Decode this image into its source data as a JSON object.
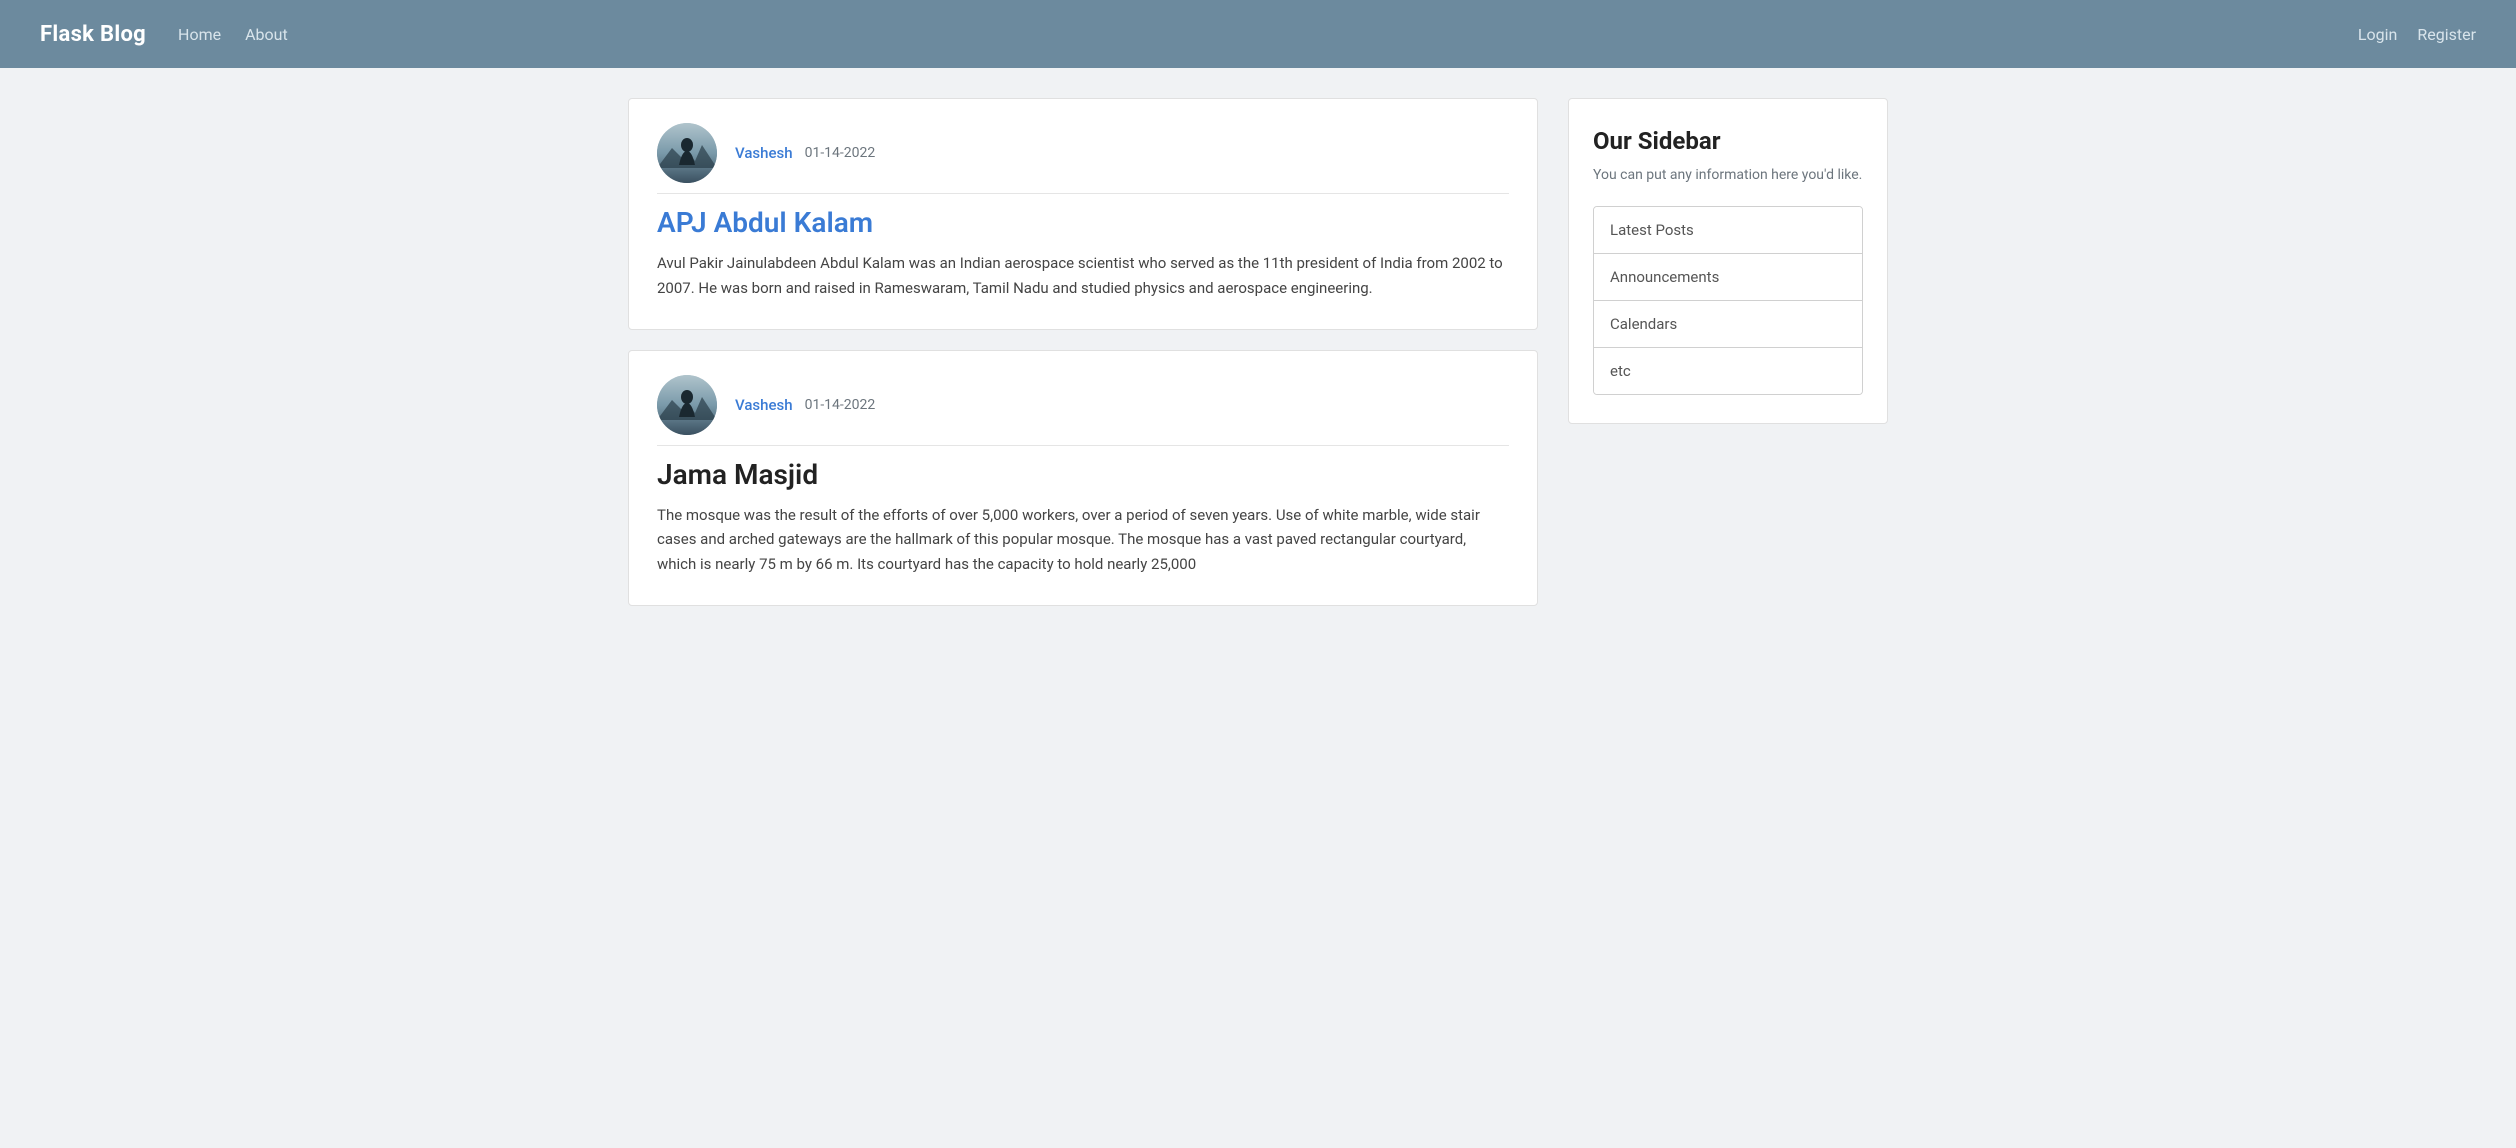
{
  "navbar": {
    "brand": "Flask Blog",
    "links": [
      {
        "label": "Home",
        "href": "#"
      },
      {
        "label": "About",
        "href": "#"
      }
    ],
    "right_links": [
      {
        "label": "Login",
        "href": "#"
      },
      {
        "label": "Register",
        "href": "#"
      }
    ]
  },
  "posts": [
    {
      "author": "Vashesh",
      "date": "01-14-2022",
      "title": "APJ Abdul Kalam",
      "title_style": "blue",
      "body": "Avul Pakir Jainulabdeen Abdul Kalam was an Indian aerospace scientist who served as the 11th president of India from 2002 to 2007. He was born and raised in Rameswaram, Tamil Nadu and studied physics and aerospace engineering."
    },
    {
      "author": "Vashesh",
      "date": "01-14-2022",
      "title": "Jama Masjid",
      "title_style": "dark",
      "body": "The mosque was the result of the efforts of over 5,000 workers, over a period of seven years. Use of white marble, wide stair cases and arched gateways are the hallmark of this popular mosque. The mosque has a vast paved rectangular courtyard, which is nearly 75 m by 66 m. Its courtyard has the capacity to hold nearly 25,000"
    }
  ],
  "sidebar": {
    "title": "Our Sidebar",
    "description": "You can put any information here you'd like.",
    "items": [
      {
        "label": "Latest Posts"
      },
      {
        "label": "Announcements"
      },
      {
        "label": "Calendars"
      },
      {
        "label": "etc"
      }
    ]
  }
}
